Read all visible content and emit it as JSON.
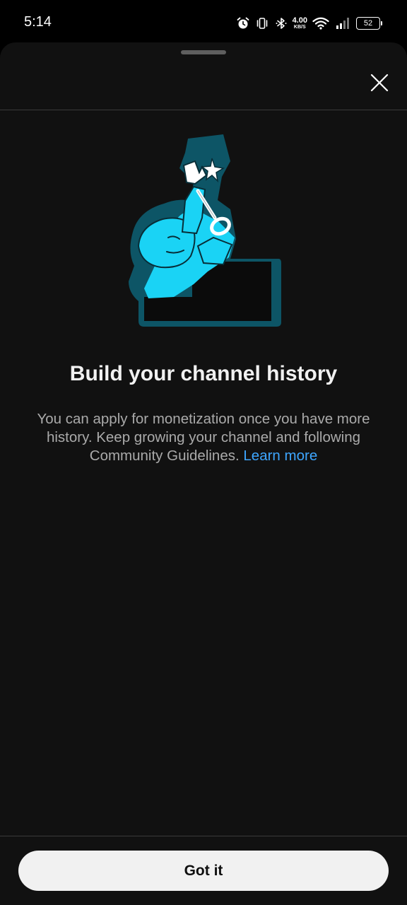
{
  "status_bar": {
    "time": "5:14",
    "net_speed_value": "4.00",
    "net_speed_unit": "KB/S",
    "battery_level": "52",
    "icons": [
      "alarm-icon",
      "vibrate-icon",
      "bluetooth-icon",
      "wifi-icon",
      "signal-icon",
      "battery-icon"
    ]
  },
  "sheet": {
    "close_icon": "close-icon",
    "illustration": "person-holding-key-on-stairs-illustration",
    "title": "Build your channel history",
    "body_text": "You can apply for monetization once you have more history. Keep growing your channel and following Community Guidelines.",
    "learn_more_label": "Learn more",
    "confirm_label": "Got it"
  },
  "colors": {
    "sheet_background": "#111111",
    "link": "#3ea6ff",
    "illustration_cyan": "#1ad3f5",
    "illustration_teal": "#0d5566",
    "button_background": "#f1f1f1"
  }
}
